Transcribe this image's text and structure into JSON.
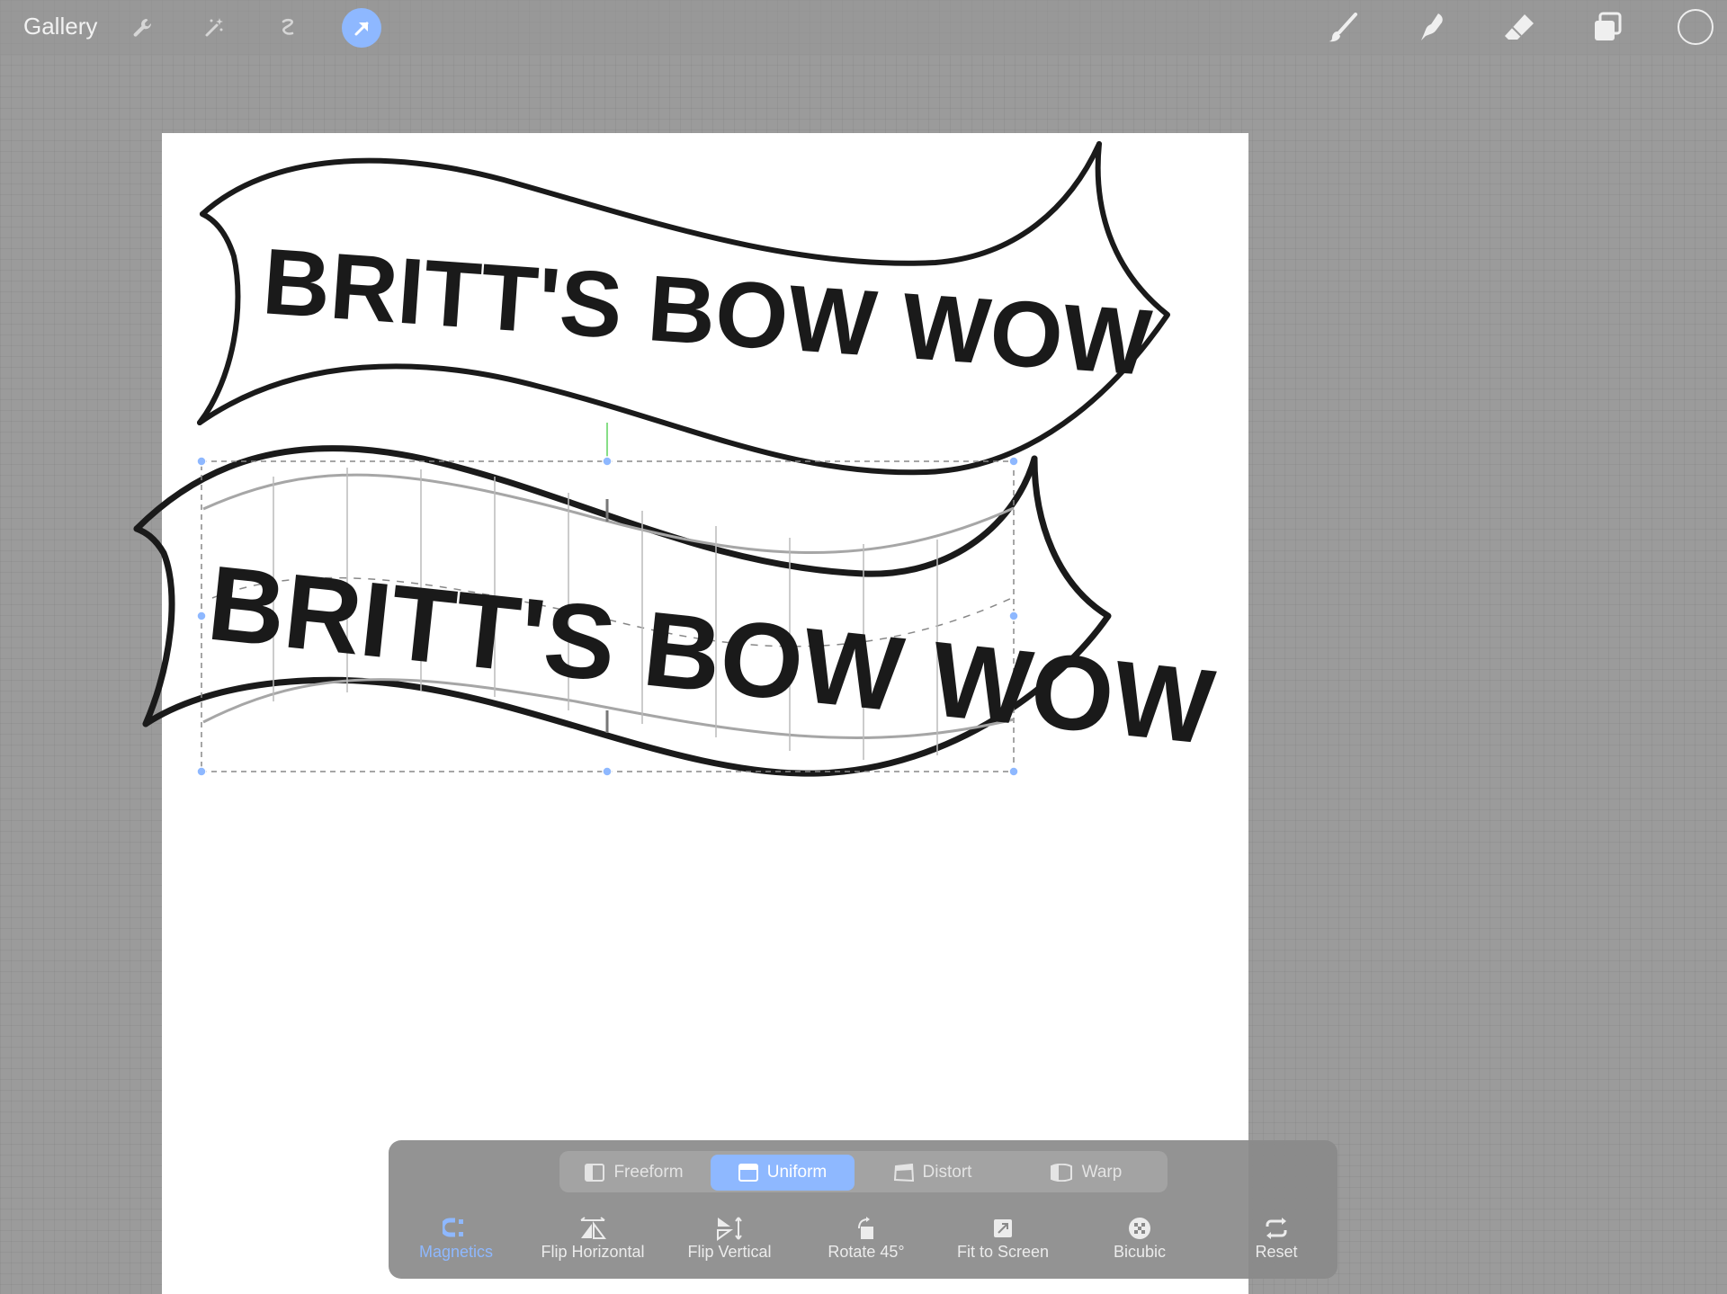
{
  "toolbar": {
    "gallery_label": "Gallery",
    "left_tools": [
      "wrench-icon",
      "magic-wand-icon",
      "selection-icon",
      "transform-arrow-icon"
    ],
    "right_tools": [
      "brush-icon",
      "smudge-icon",
      "eraser-icon",
      "layers-icon"
    ],
    "active_tool": "transform-arrow-icon",
    "accent_color": "#8eb8ff"
  },
  "canvas": {
    "banner_top_text": "BRITT'S BOW WOW",
    "banner_bottom_text": "BRITT'S BOW WOW"
  },
  "transform_panel": {
    "modes": [
      {
        "label": "Freeform",
        "icon": "freeform-icon",
        "active": false
      },
      {
        "label": "Uniform",
        "icon": "uniform-icon",
        "active": true
      },
      {
        "label": "Distort",
        "icon": "distort-icon",
        "active": false
      },
      {
        "label": "Warp",
        "icon": "warp-icon",
        "active": false
      }
    ],
    "actions": [
      {
        "label": "Magnetics",
        "icon": "magnet-icon",
        "active": true
      },
      {
        "label": "Flip Horizontal",
        "icon": "flip-horizontal-icon",
        "active": false
      },
      {
        "label": "Flip Vertical",
        "icon": "flip-vertical-icon",
        "active": false
      },
      {
        "label": "Rotate 45°",
        "icon": "rotate-icon",
        "active": false
      },
      {
        "label": "Fit to Screen",
        "icon": "fit-screen-icon",
        "active": false
      },
      {
        "label": "Bicubic",
        "icon": "bicubic-icon",
        "active": false
      },
      {
        "label": "Reset",
        "icon": "reset-icon",
        "active": false
      }
    ]
  }
}
